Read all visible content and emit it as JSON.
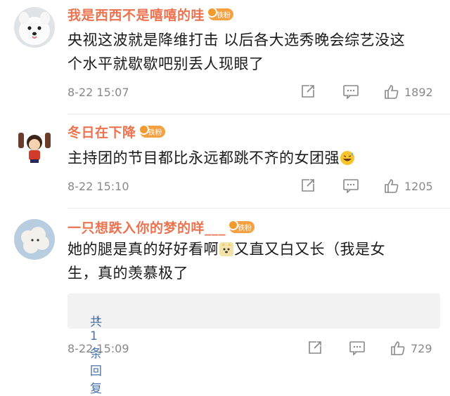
{
  "comments": [
    {
      "username": "我是西西不是嘻嘻的哇",
      "badge": "铁粉",
      "text_line1": "央视这波就是降维打击 以后各大选秀晚会综艺没这",
      "text_line2": "个水平就歇歇吧别丢人现眼了",
      "time": "8-22 15:07",
      "likes": "1892",
      "avatar_icon": "white-dog-avatar"
    },
    {
      "username": "冬日在下降",
      "badge": "铁粉",
      "text": "主持团的节目都比永远都跳不齐的女团强",
      "emoji_icon": "sweat-smile-emoji",
      "time": "8-22 15:10",
      "likes": "1205",
      "avatar_icon": "cartoon-girl-avatar"
    },
    {
      "username": "一只想跌入你的梦的咩___",
      "badge": "铁粉",
      "text_part1": "她的腿是真的好好看啊",
      "emoji_icon": "doge-emoji",
      "text_part2": "又直又白又长（我是女",
      "text_line2": "生，真的羡慕极了",
      "replies_label": "共1条回复",
      "replies_chevron": "›",
      "time": "8-22 15:09",
      "likes": "729",
      "avatar_icon": "cloud-sheep-avatar"
    }
  ],
  "colors": {
    "username": "#eb7350",
    "badge": "#f5a142",
    "link": "#4a72a8",
    "meta": "#888888"
  }
}
